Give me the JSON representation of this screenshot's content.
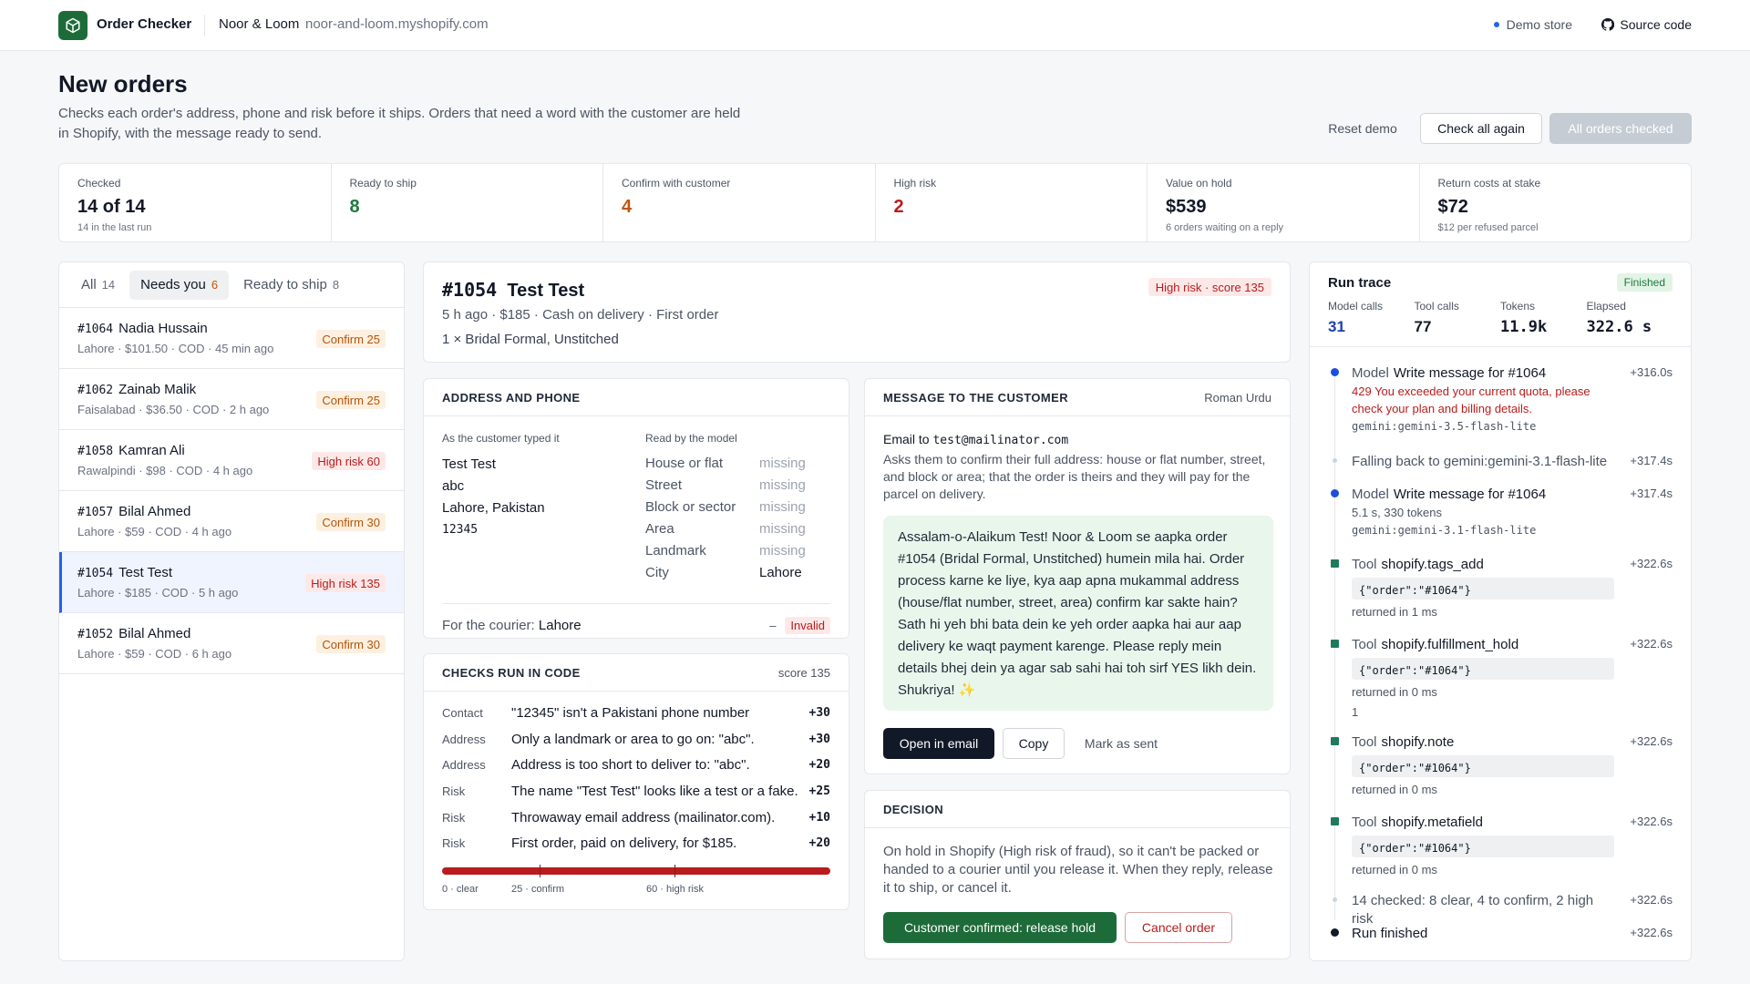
{
  "topbar": {
    "app_title": "Order Checker",
    "store_name": "Noor & Loom",
    "store_domain": "noor-and-loom.myshopify.com",
    "demo_label": "Demo store",
    "source_label": "Source code"
  },
  "page": {
    "title": "New orders",
    "subtitle": "Checks each order's address, phone and risk before it ships. Orders that need a word with the customer are held in Shopify, with the message ready to send.",
    "reset_label": "Reset demo",
    "check_again_label": "Check all again",
    "all_checked_label": "All orders checked"
  },
  "stats": [
    {
      "label": "Checked",
      "value": "14 of 14",
      "sub": "14 in the last run"
    },
    {
      "label": "Ready to ship",
      "value": "8",
      "sub": ""
    },
    {
      "label": "Confirm with customer",
      "value": "4",
      "sub": ""
    },
    {
      "label": "High risk",
      "value": "2",
      "sub": ""
    },
    {
      "label": "Value on hold",
      "value": "$539",
      "sub": "6 orders waiting on a reply"
    },
    {
      "label": "Return costs at stake",
      "value": "$72",
      "sub": "$12 per refused parcel"
    }
  ],
  "tabs": [
    {
      "label": "All",
      "count": "14"
    },
    {
      "label": "Needs you",
      "count": "6"
    },
    {
      "label": "Ready to ship",
      "count": "8"
    }
  ],
  "orders": [
    {
      "num": "#1064",
      "name": "Nadia Hussain",
      "meta": "Lahore · $101.50 · COD · 45 min ago",
      "badge": "Confirm 25"
    },
    {
      "num": "#1062",
      "name": "Zainab Malik",
      "meta": "Faisalabad · $36.50 · COD · 2 h ago",
      "badge": "Confirm 25"
    },
    {
      "num": "#1058",
      "name": "Kamran Ali",
      "meta": "Rawalpindi · $98 · COD · 4 h ago",
      "badge": "High risk 60"
    },
    {
      "num": "#1057",
      "name": "Bilal Ahmed",
      "meta": "Lahore · $59 · COD · 4 h ago",
      "badge": "Confirm 30"
    },
    {
      "num": "#1054",
      "name": "Test Test",
      "meta": "Lahore · $185 · COD · 5 h ago",
      "badge": "High risk 135"
    },
    {
      "num": "#1052",
      "name": "Bilal Ahmed",
      "meta": "Lahore · $59 · COD · 6 h ago",
      "badge": "Confirm 30"
    }
  ],
  "detail": {
    "num": "#1054",
    "name": "Test Test",
    "meta": "5 h ago · $185 · Cash on delivery · First order",
    "items": "1 × Bridal Formal, Unstitched",
    "risk_badge": "High risk · score 135"
  },
  "address": {
    "section_title": "ADDRESS AND PHONE",
    "typed_heading": "As the customer typed it",
    "model_heading": "Read by the model",
    "typed_lines": [
      "Test Test",
      "abc",
      "Lahore, Pakistan",
      "12345"
    ],
    "fields": [
      {
        "key": "House or flat",
        "value": "missing"
      },
      {
        "key": "Street",
        "value": "missing"
      },
      {
        "key": "Block or sector",
        "value": "missing"
      },
      {
        "key": "Area",
        "value": "missing"
      },
      {
        "key": "Landmark",
        "value": "missing"
      },
      {
        "key": "City",
        "value": "Lahore"
      }
    ],
    "courier_label": "For the courier:",
    "courier_value": "Lahore",
    "phone_dash": "–",
    "phone_status": "Invalid"
  },
  "checks": {
    "section_title": "CHECKS RUN IN CODE",
    "score": "score 135",
    "rows": [
      {
        "cat": "Contact",
        "text": "\"12345\" isn't a Pakistani phone number",
        "pts": "+30"
      },
      {
        "cat": "Address",
        "text": "Only a landmark or area to go on: \"abc\".",
        "pts": "+30"
      },
      {
        "cat": "Address",
        "text": "Address is too short to deliver to: \"abc\".",
        "pts": "+20"
      },
      {
        "cat": "Risk",
        "text": "The name \"Test Test\" looks like a test or a fake.",
        "pts": "+25"
      },
      {
        "cat": "Risk",
        "text": "Throwaway email address (mailinator.com).",
        "pts": "+10"
      },
      {
        "cat": "Risk",
        "text": "First order, paid on delivery, for $185.",
        "pts": "+20"
      }
    ],
    "scale_labels": [
      "0 · clear",
      "25 · confirm",
      "60 · high risk"
    ],
    "color": "#b91c1c"
  },
  "message": {
    "section_title": "MESSAGE TO THE CUSTOMER",
    "language": "Roman Urdu",
    "email_prefix": "Email to",
    "email": "test@mailinator.com",
    "description": "Asks them to confirm their full address: house or flat number, street, and block or area; that the order is theirs and they will pay for the parcel on delivery.",
    "body": "Assalam-o-Alaikum Test! Noor & Loom se aapka order #1054 (Bridal Formal, Unstitched) humein mila hai. Order process karne ke liye, kya aap apna mukammal address (house/flat number, street, area) confirm kar sakte hain? Sath hi yeh bhi bata dein ke yeh order aapka hai aur aap delivery ke waqt payment karenge. Please reply mein details bhej dein ya agar sab sahi hai toh sirf YES likh dein. Shukriya! ✨",
    "open_label": "Open in email",
    "copy_label": "Copy",
    "mark_label": "Mark as sent"
  },
  "decision": {
    "section_title": "DECISION",
    "text": "On hold in Shopify (High risk of fraud), so it can't be packed or handed to a courier until you release it. When they reply, release it to ship, or cancel it.",
    "release_label": "Customer confirmed: release hold",
    "cancel_label": "Cancel order"
  },
  "trace": {
    "title": "Run trace",
    "status": "Finished",
    "stats": [
      {
        "label": "Model calls",
        "value": "31"
      },
      {
        "label": "Tool calls",
        "value": "77"
      },
      {
        "label": "Tokens",
        "value": "11.9k"
      },
      {
        "label": "Elapsed",
        "value": "322.6 s"
      }
    ],
    "events": [
      {
        "kind": "Model",
        "title": "Write message for #1064",
        "time": "+316.0s",
        "error": "429 You exceeded your current quota, please check your plan and billing details.",
        "model": "gemini:gemini-3.5-flash-lite"
      },
      {
        "text": "Falling back to gemini:gemini-3.1-flash-lite",
        "time": "+317.4s"
      },
      {
        "kind": "Model",
        "title": "Write message for #1064",
        "time": "+317.4s",
        "sub": "5.1 s, 330 tokens",
        "model": "gemini:gemini-3.1-flash-lite"
      },
      {
        "kind": "Tool",
        "title": "shopify.tags_add",
        "time": "+322.6s",
        "code": "{\"order\":\"#1064\"}",
        "ret": "returned in 1 ms"
      },
      {
        "kind": "Tool",
        "title": "shopify.fulfillment_hold",
        "time": "+322.6s",
        "code": "{\"order\":\"#1064\"}",
        "ret": "returned in 0 ms",
        "extra": "1"
      },
      {
        "kind": "Tool",
        "title": "shopify.note",
        "time": "+322.6s",
        "code": "{\"order\":\"#1064\"}",
        "ret": "returned in 0 ms"
      },
      {
        "kind": "Tool",
        "title": "shopify.metafield",
        "time": "+322.6s",
        "code": "{\"order\":\"#1064\"}",
        "ret": "returned in 0 ms"
      },
      {
        "text": "14 checked: 8 clear, 4 to confirm, 2 high risk",
        "time": "+322.6s"
      },
      {
        "text": "Run finished",
        "time": "+322.6s"
      }
    ]
  },
  "colors": {
    "brand": "#1e6b3a",
    "accent": "#2563eb",
    "danger": "#b91c1c",
    "warning": "#c2560c"
  }
}
